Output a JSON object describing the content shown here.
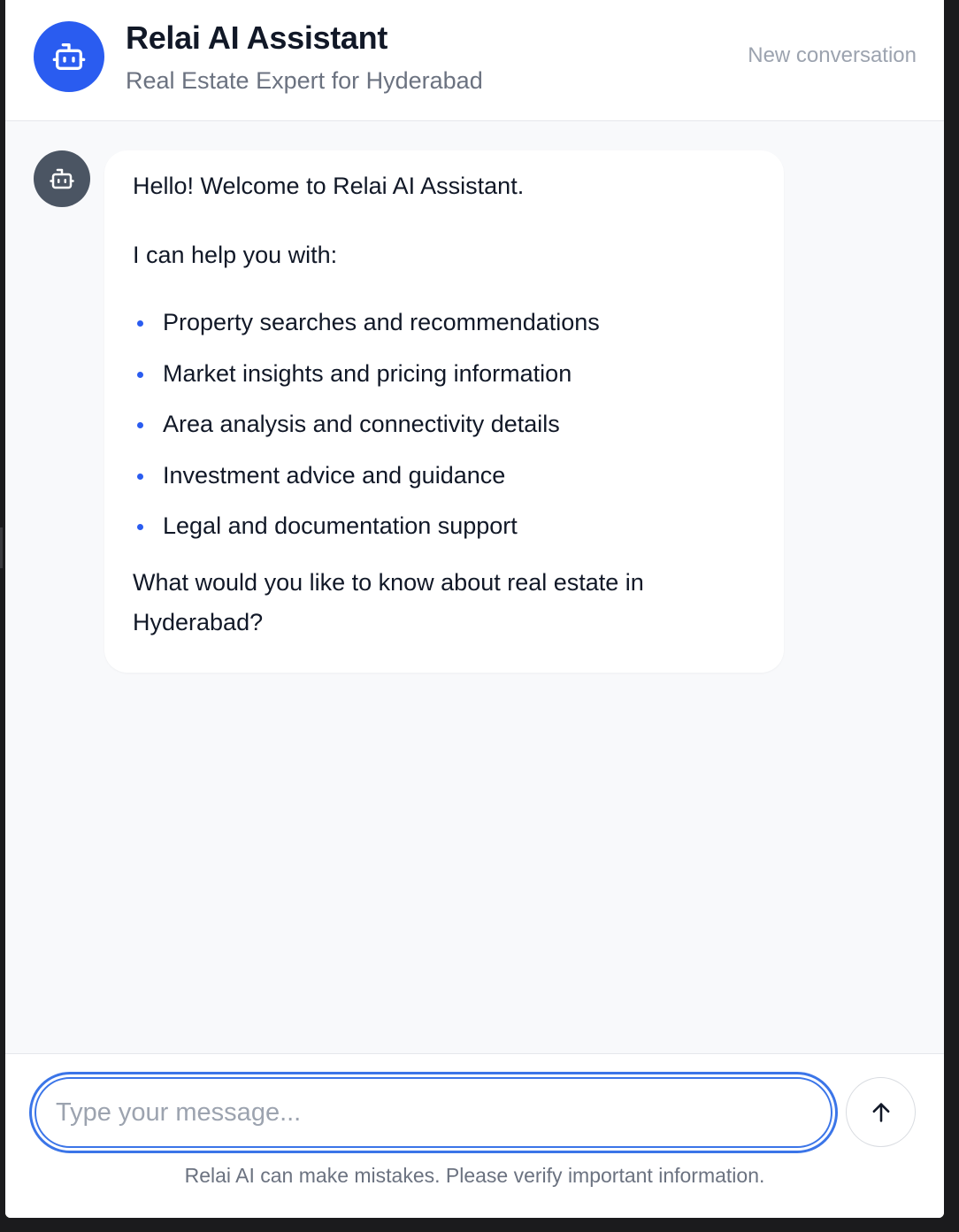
{
  "header": {
    "title": "Relai AI Assistant",
    "subtitle": "Real Estate Expert for Hyderabad",
    "new_conversation_label": "New conversation",
    "avatar_icon": "bot-icon"
  },
  "colors": {
    "accent": "#2a5cf0",
    "bot_avatar_bg": "#4b5563",
    "chat_bg": "#f8f9fb"
  },
  "messages": [
    {
      "role": "assistant",
      "avatar_icon": "bot-icon",
      "greeting": "Hello! Welcome to Relai AI Assistant.",
      "intro": "I can help you with:",
      "items": [
        "Property searches and recommendations",
        "Market insights and pricing information",
        "Area analysis and connectivity details",
        "Investment advice and guidance",
        "Legal and documentation support"
      ],
      "question": "What would you like to know about real estate in Hyderabad?"
    }
  ],
  "composer": {
    "value": "",
    "placeholder": "Type your message...",
    "send_icon": "arrow-up-icon",
    "disclaimer": "Relai AI can make mistakes. Please verify important information."
  }
}
